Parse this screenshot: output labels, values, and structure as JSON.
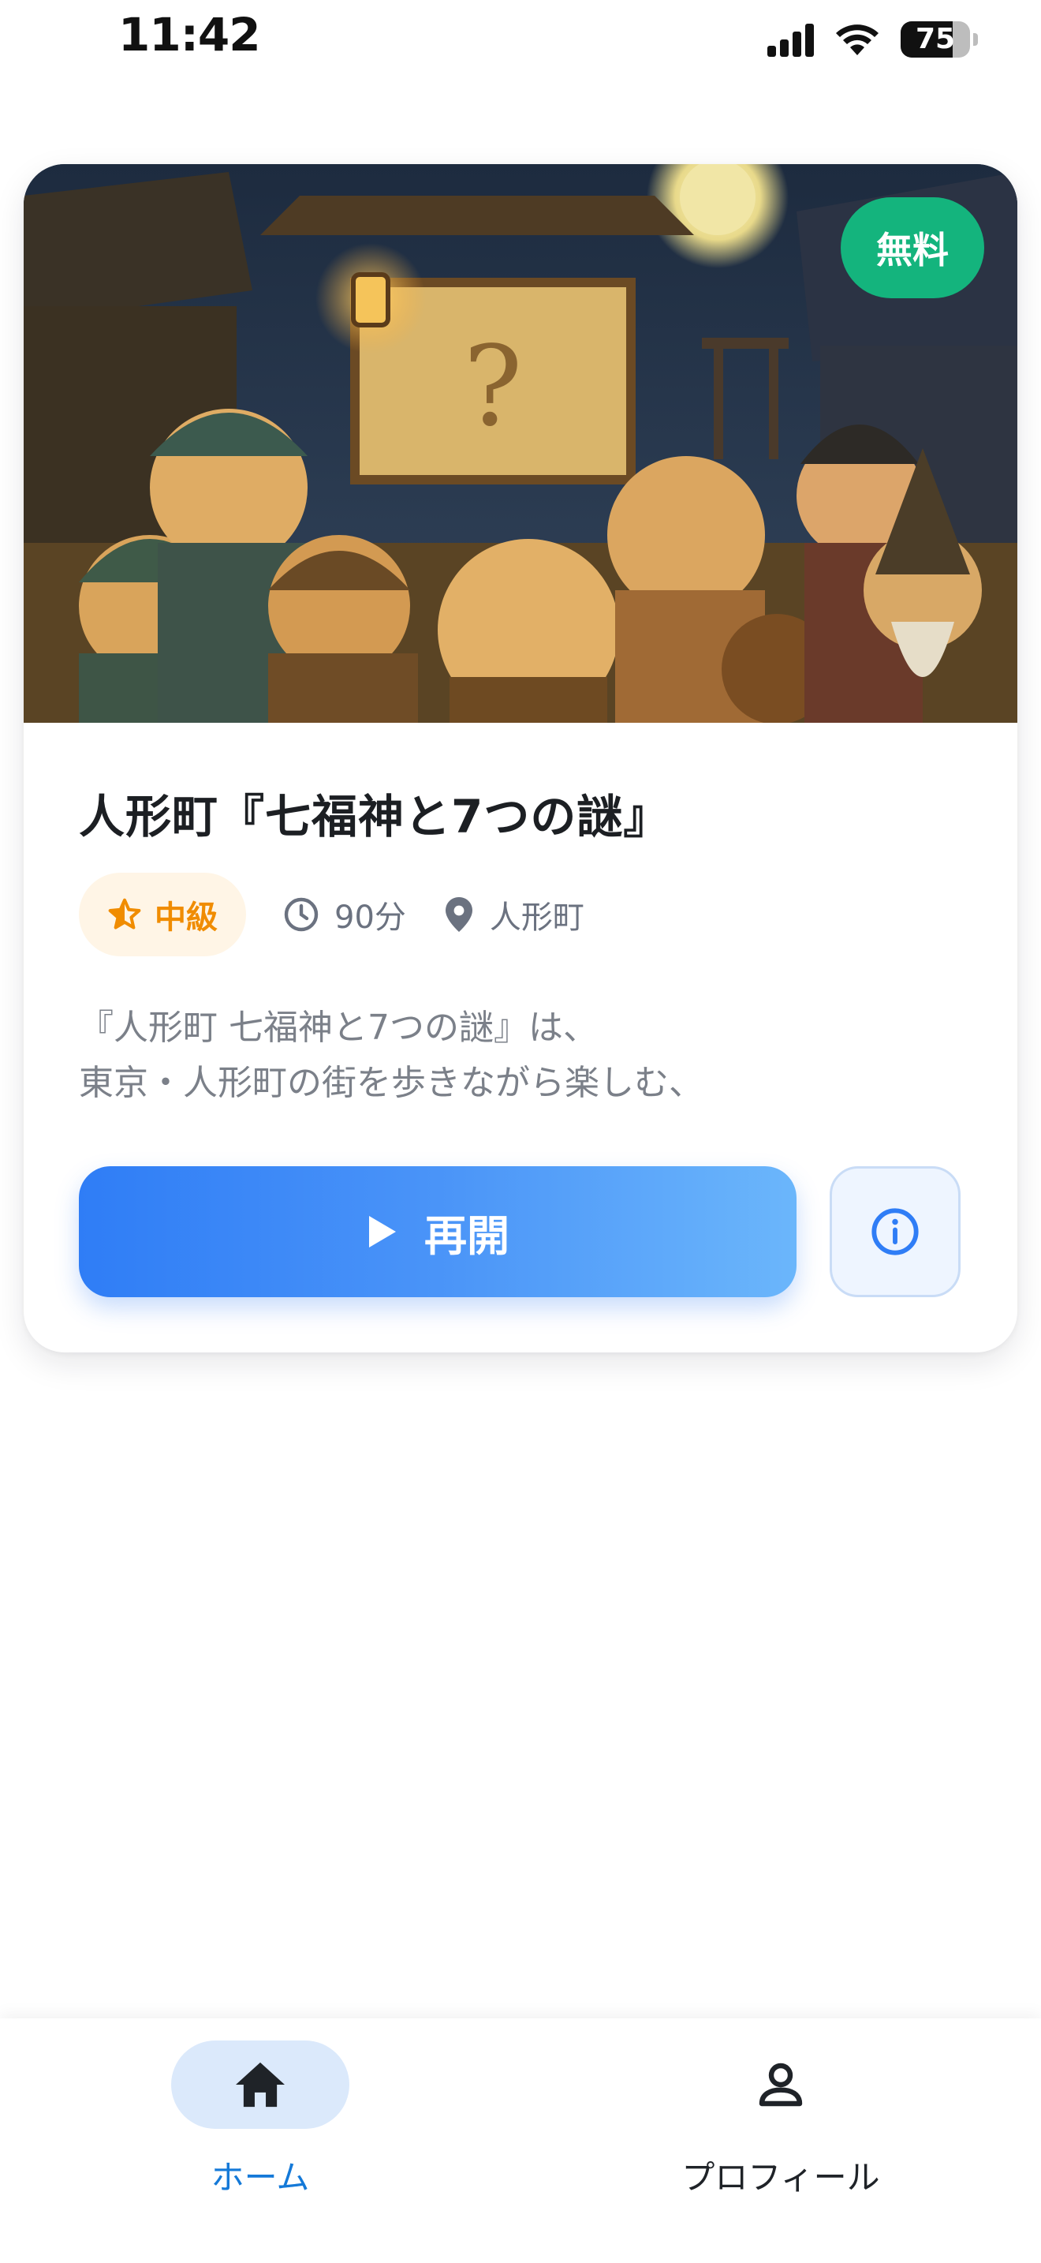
{
  "status_bar": {
    "time": "11:42",
    "battery_percent": "75",
    "battery_level": 0.75
  },
  "card": {
    "badge": "無料",
    "title": "人形町『七福神と7つの謎』",
    "level": "中級",
    "duration": "90分",
    "location": "人形町",
    "description_lines": [
      "『人形町 七福神と7つの謎』は、",
      "東京・人形町の街を歩きながら楽しむ、"
    ],
    "resume_label": "再開",
    "colors": {
      "badge": "#14b47d",
      "level": "#f08c00",
      "button_start": "#2f7df6",
      "button_end": "#6bb6fb"
    },
    "icons": {
      "level": "star-half-icon",
      "duration": "clock-icon",
      "location": "map-pin-icon",
      "resume": "play-icon",
      "info": "info-icon"
    }
  },
  "tab_bar": {
    "items": [
      {
        "label": "ホーム",
        "icon": "home-icon",
        "active": true
      },
      {
        "label": "プロフィール",
        "icon": "person-icon",
        "active": false
      }
    ],
    "active_color": "#1479d8"
  }
}
